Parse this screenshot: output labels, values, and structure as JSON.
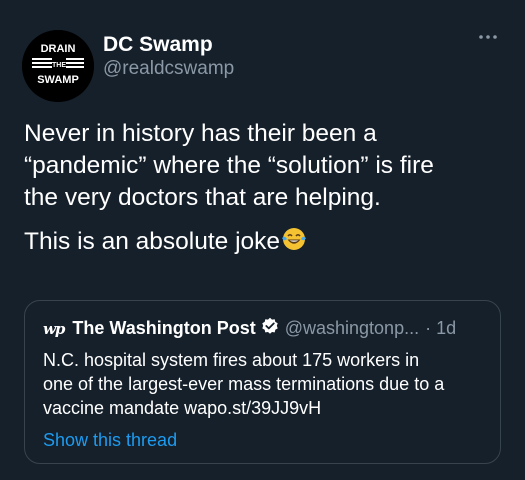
{
  "author": {
    "name": "DC Swamp",
    "handle": "@realdcswamp",
    "avatar": {
      "line1": "DRAIN",
      "line2": "THE",
      "line3": "SWAMP"
    }
  },
  "more_icon": "more-horizontal-icon",
  "tweet": {
    "lines": [
      "Never in history has their been a",
      "“pandemic” where the “solution” is fire",
      "the very doctors that are helping."
    ],
    "second_paragraph": "This is an absolute joke",
    "emoji": "laughing-tears-emoji"
  },
  "quoted_tweet": {
    "logo": "wp",
    "source_name": "The Washington Post",
    "verified_icon": "verified-badge-icon",
    "handle": "@washingtonp...",
    "time": "· 1d",
    "lines": [
      "N.C. hospital system fires about 175 workers in",
      "one of the largest-ever mass terminations due to a",
      "vaccine mandate wapo.st/39JJ9vH"
    ],
    "show_thread_label": "Show this thread"
  },
  "colors": {
    "background": "#15202b",
    "secondary_text": "#8b98a5",
    "link": "#1d9bf0",
    "border": "#38444d"
  }
}
